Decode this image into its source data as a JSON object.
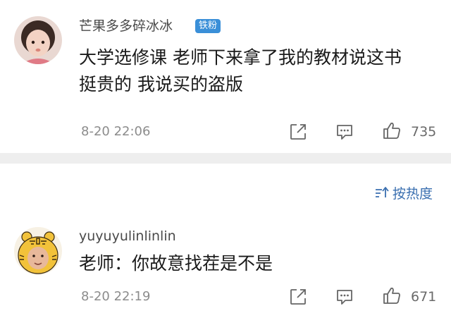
{
  "comments": [
    {
      "username": "芒果多多碎冰冰",
      "badge": "铁粉",
      "text_lines": [
        "大学选修课  老师下来拿了我的教材说这书",
        "挺贵的   我说买的盗版"
      ],
      "time": "8-20 22:06",
      "likes": "735"
    },
    {
      "username": "yuyuyulinlinlin",
      "text_lines": [
        "老师：你故意找茬是不是"
      ],
      "time": "8-20 22:19",
      "likes": "671"
    }
  ],
  "sort": {
    "label": "按热度",
    "icon": "sort-icon"
  },
  "icons": {
    "share": "share-icon",
    "comment": "comment-icon",
    "like": "thumbs-up-icon"
  },
  "colors": {
    "badge": "#3a8fd8",
    "sort": "#3a6fb0",
    "muted_text": "#8c8c8c",
    "divider": "#eeeeee"
  }
}
